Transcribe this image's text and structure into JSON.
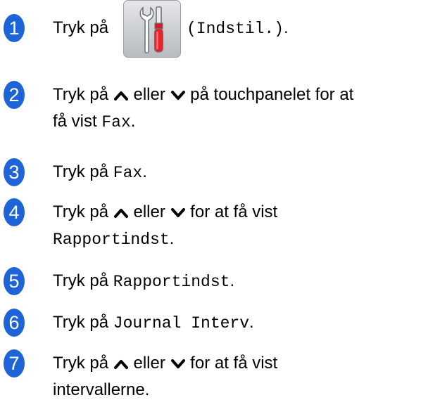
{
  "steps": [
    {
      "number": "1",
      "t1": "Tryk på",
      "mono1": "(Indstil.)",
      "t2": "."
    },
    {
      "number": "2",
      "t1": "Tryk på",
      "t2": "eller",
      "t3": "på touchpanelet for at",
      "t4": "få vist",
      "mono1": "Fax",
      "t5": "."
    },
    {
      "number": "3",
      "t1": "Tryk på",
      "mono1": "Fax",
      "t2": "."
    },
    {
      "number": "4",
      "t1": "Tryk på",
      "t2": "eller",
      "t3": "for at få vist",
      "mono1": "Rapportindst",
      "t4": "."
    },
    {
      "number": "5",
      "t1": "Tryk på",
      "mono1": "Rapportindst",
      "t2": "."
    },
    {
      "number": "6",
      "t1": "Tryk på",
      "mono1": "Journal Interv",
      "t2": "."
    },
    {
      "number": "7",
      "t1": "Tryk på",
      "t2": "eller",
      "t3": "for at få vist",
      "t4": "intervallerne."
    }
  ],
  "icons": {
    "settings": "settings-tools-icon",
    "up": "chevron-up-icon",
    "down": "chevron-down-icon"
  },
  "colors": {
    "step_badge": "#1e64d6"
  }
}
